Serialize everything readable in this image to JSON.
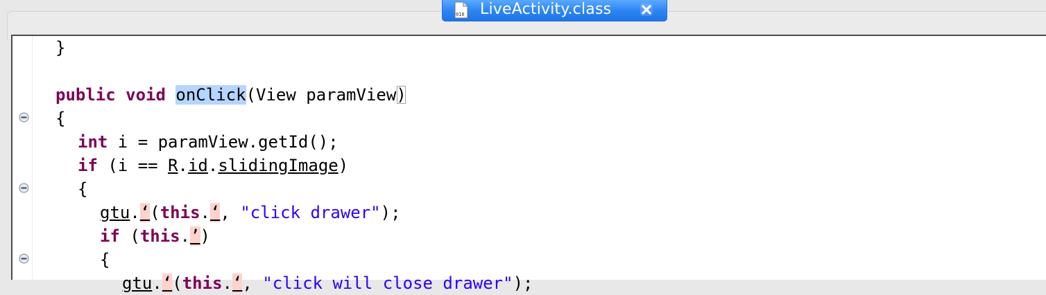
{
  "tab": {
    "title": "LiveActivity.class",
    "icon": "class-file-icon",
    "icon_caption": "010",
    "accent": "#2e86f5"
  },
  "code": {
    "line1": "}",
    "line3_kw1": "public",
    "line3_kw2": "void",
    "line3_method": "onClick",
    "line3_open": "(",
    "line3_params": "View paramView",
    "line3_close": ")",
    "line4": "{",
    "line5_kw": "int",
    "line5_rest": " i = paramView.getId();",
    "line6_kw": "if",
    "line6_a": " (i == ",
    "line6_r": "R",
    "line6_dot1": ".",
    "line6_id": "id",
    "line6_dot2": ".",
    "line6_field": "slidingImage",
    "line6_end": ")",
    "line7": "{",
    "line8_obj": "gtu",
    "line8_dot": ".",
    "line8_err1": "ʻ",
    "line8_open": "(",
    "line8_this": "this",
    "line8_dot2": ".",
    "line8_err2": "‘",
    "line8_sep": ", ",
    "line8_str": "\"click drawer\"",
    "line8_end": ");",
    "line9_kw": "if",
    "line9_open": " (",
    "line9_this": "this",
    "line9_dot": ".",
    "line9_err": "ʼ",
    "line9_end": ")",
    "line10": "{",
    "line11_obj": "gtu",
    "line11_dot": ".",
    "line11_err1": "ʻ",
    "line11_open": "(",
    "line11_this": "this",
    "line11_dot2": ".",
    "line11_err2": "‘",
    "line11_sep": ", ",
    "line11_str": "\"click will close drawer\"",
    "line11_end": ");"
  },
  "colors": {
    "keyword": "#7f0055",
    "string": "#2a00ff",
    "selection": "#b5d5ff",
    "error": "#ffd2cc"
  }
}
